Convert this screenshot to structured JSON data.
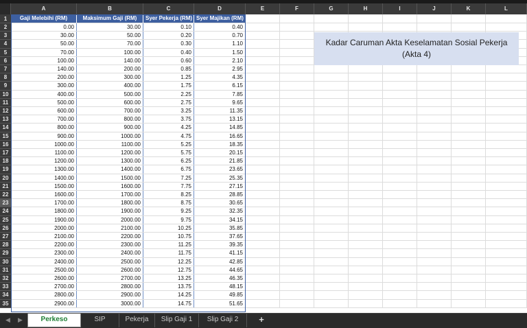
{
  "columns": [
    "A",
    "B",
    "C",
    "D",
    "E",
    "F",
    "G",
    "H",
    "I",
    "J",
    "K",
    "L"
  ],
  "table": {
    "headers": [
      "Gaji Melebihi (RM)",
      "Maksimum Gaji (RM)",
      "Syer Pekerja (RM)",
      "Syer Majikan (RM)"
    ],
    "rows": [
      [
        "0.00",
        "30.00",
        "0.10",
        "0.40"
      ],
      [
        "30.00",
        "50.00",
        "0.20",
        "0.70"
      ],
      [
        "50.00",
        "70.00",
        "0.30",
        "1.10"
      ],
      [
        "70.00",
        "100.00",
        "0.40",
        "1.50"
      ],
      [
        "100.00",
        "140.00",
        "0.60",
        "2.10"
      ],
      [
        "140.00",
        "200.00",
        "0.85",
        "2.95"
      ],
      [
        "200.00",
        "300.00",
        "1.25",
        "4.35"
      ],
      [
        "300.00",
        "400.00",
        "1.75",
        "6.15"
      ],
      [
        "400.00",
        "500.00",
        "2.25",
        "7.85"
      ],
      [
        "500.00",
        "600.00",
        "2.75",
        "9.65"
      ],
      [
        "600.00",
        "700.00",
        "3.25",
        "11.35"
      ],
      [
        "700.00",
        "800.00",
        "3.75",
        "13.15"
      ],
      [
        "800.00",
        "900.00",
        "4.25",
        "14.85"
      ],
      [
        "900.00",
        "1000.00",
        "4.75",
        "16.65"
      ],
      [
        "1000.00",
        "1100.00",
        "5.25",
        "18.35"
      ],
      [
        "1100.00",
        "1200.00",
        "5.75",
        "20.15"
      ],
      [
        "1200.00",
        "1300.00",
        "6.25",
        "21.85"
      ],
      [
        "1300.00",
        "1400.00",
        "6.75",
        "23.65"
      ],
      [
        "1400.00",
        "1500.00",
        "7.25",
        "25.35"
      ],
      [
        "1500.00",
        "1600.00",
        "7.75",
        "27.15"
      ],
      [
        "1600.00",
        "1700.00",
        "8.25",
        "28.85"
      ],
      [
        "1700.00",
        "1800.00",
        "8.75",
        "30.65"
      ],
      [
        "1800.00",
        "1900.00",
        "9.25",
        "32.35"
      ],
      [
        "1900.00",
        "2000.00",
        "9.75",
        "34.15"
      ],
      [
        "2000.00",
        "2100.00",
        "10.25",
        "35.85"
      ],
      [
        "2100.00",
        "2200.00",
        "10.75",
        "37.65"
      ],
      [
        "2200.00",
        "2300.00",
        "11.25",
        "39.35"
      ],
      [
        "2300.00",
        "2400.00",
        "11.75",
        "41.15"
      ],
      [
        "2400.00",
        "2500.00",
        "12.25",
        "42.85"
      ],
      [
        "2500.00",
        "2600.00",
        "12.75",
        "44.65"
      ],
      [
        "2600.00",
        "2700.00",
        "13.25",
        "46.35"
      ],
      [
        "2700.00",
        "2800.00",
        "13.75",
        "48.15"
      ],
      [
        "2800.00",
        "2900.00",
        "14.25",
        "49.85"
      ],
      [
        "2900.00",
        "3000.00",
        "14.75",
        "51.65"
      ]
    ]
  },
  "selected_row": 23,
  "title_box": {
    "line1": "Kadar Caruman Akta Keselamatan Sosial Pekerja",
    "line2": "(Akta 4)"
  },
  "tabs": [
    {
      "label": "Perkeso",
      "active": true
    },
    {
      "label": "SIP",
      "active": false
    },
    {
      "label": "Pekerja",
      "active": false
    },
    {
      "label": "Slip Gaji 1",
      "active": false
    },
    {
      "label": "Slip Gaji 2",
      "active": false
    }
  ],
  "nav": {
    "prev_icon": "◀",
    "next_icon": "▶",
    "add_label": "+"
  }
}
